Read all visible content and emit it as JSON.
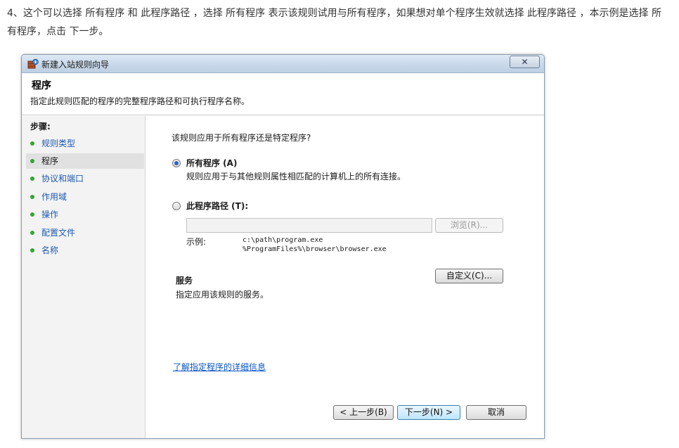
{
  "article": {
    "text": "4、这个可以选择 所有程序 和 此程序路径 ，选择 所有程序 表示该规则试用与所有程序，如果想对单个程序生效就选择 此程序路径 ，本示例是选择 所有程序，点击 下一步。"
  },
  "window": {
    "title": "新建入站规则向导",
    "close_label": "✕",
    "header": {
      "title": "程序",
      "description": "指定此规则匹配的程序的完整程序路径和可执行程序名称。"
    },
    "steps": {
      "title": "步骤:",
      "items": [
        {
          "label": "规则类型",
          "active": false
        },
        {
          "label": "程序",
          "active": true
        },
        {
          "label": "协议和端口",
          "active": false
        },
        {
          "label": "作用域",
          "active": false
        },
        {
          "label": "操作",
          "active": false
        },
        {
          "label": "配置文件",
          "active": false
        },
        {
          "label": "名称",
          "active": false
        }
      ]
    },
    "content": {
      "question": "该规则应用于所有程序还是特定程序?",
      "option_all": {
        "label": "所有程序 (A)",
        "description": "规则应用于与其他规则属性相匹配的计算机上的所有连接。",
        "selected": true
      },
      "option_path": {
        "label": "此程序路径 (T):",
        "selected": false,
        "input_value": "",
        "browse_label": "浏览(R)...",
        "example_label": "示例:",
        "example_line1": "c:\\path\\program.exe",
        "example_line2": "%ProgramFiles%\\browser\\browser.exe"
      },
      "services": {
        "title": "服务",
        "description": "指定应用该规则的服务。",
        "customize_label": "自定义(C)..."
      },
      "learn_more_link": "了解指定程序的详细信息"
    },
    "buttons": {
      "back": "< 上一步(B)",
      "next": "下一步(N) >",
      "cancel": "取消"
    }
  },
  "colors": {
    "link": "#0a55c2",
    "step_bullet": "#35a431",
    "radio_checked": "#2a62c9"
  }
}
